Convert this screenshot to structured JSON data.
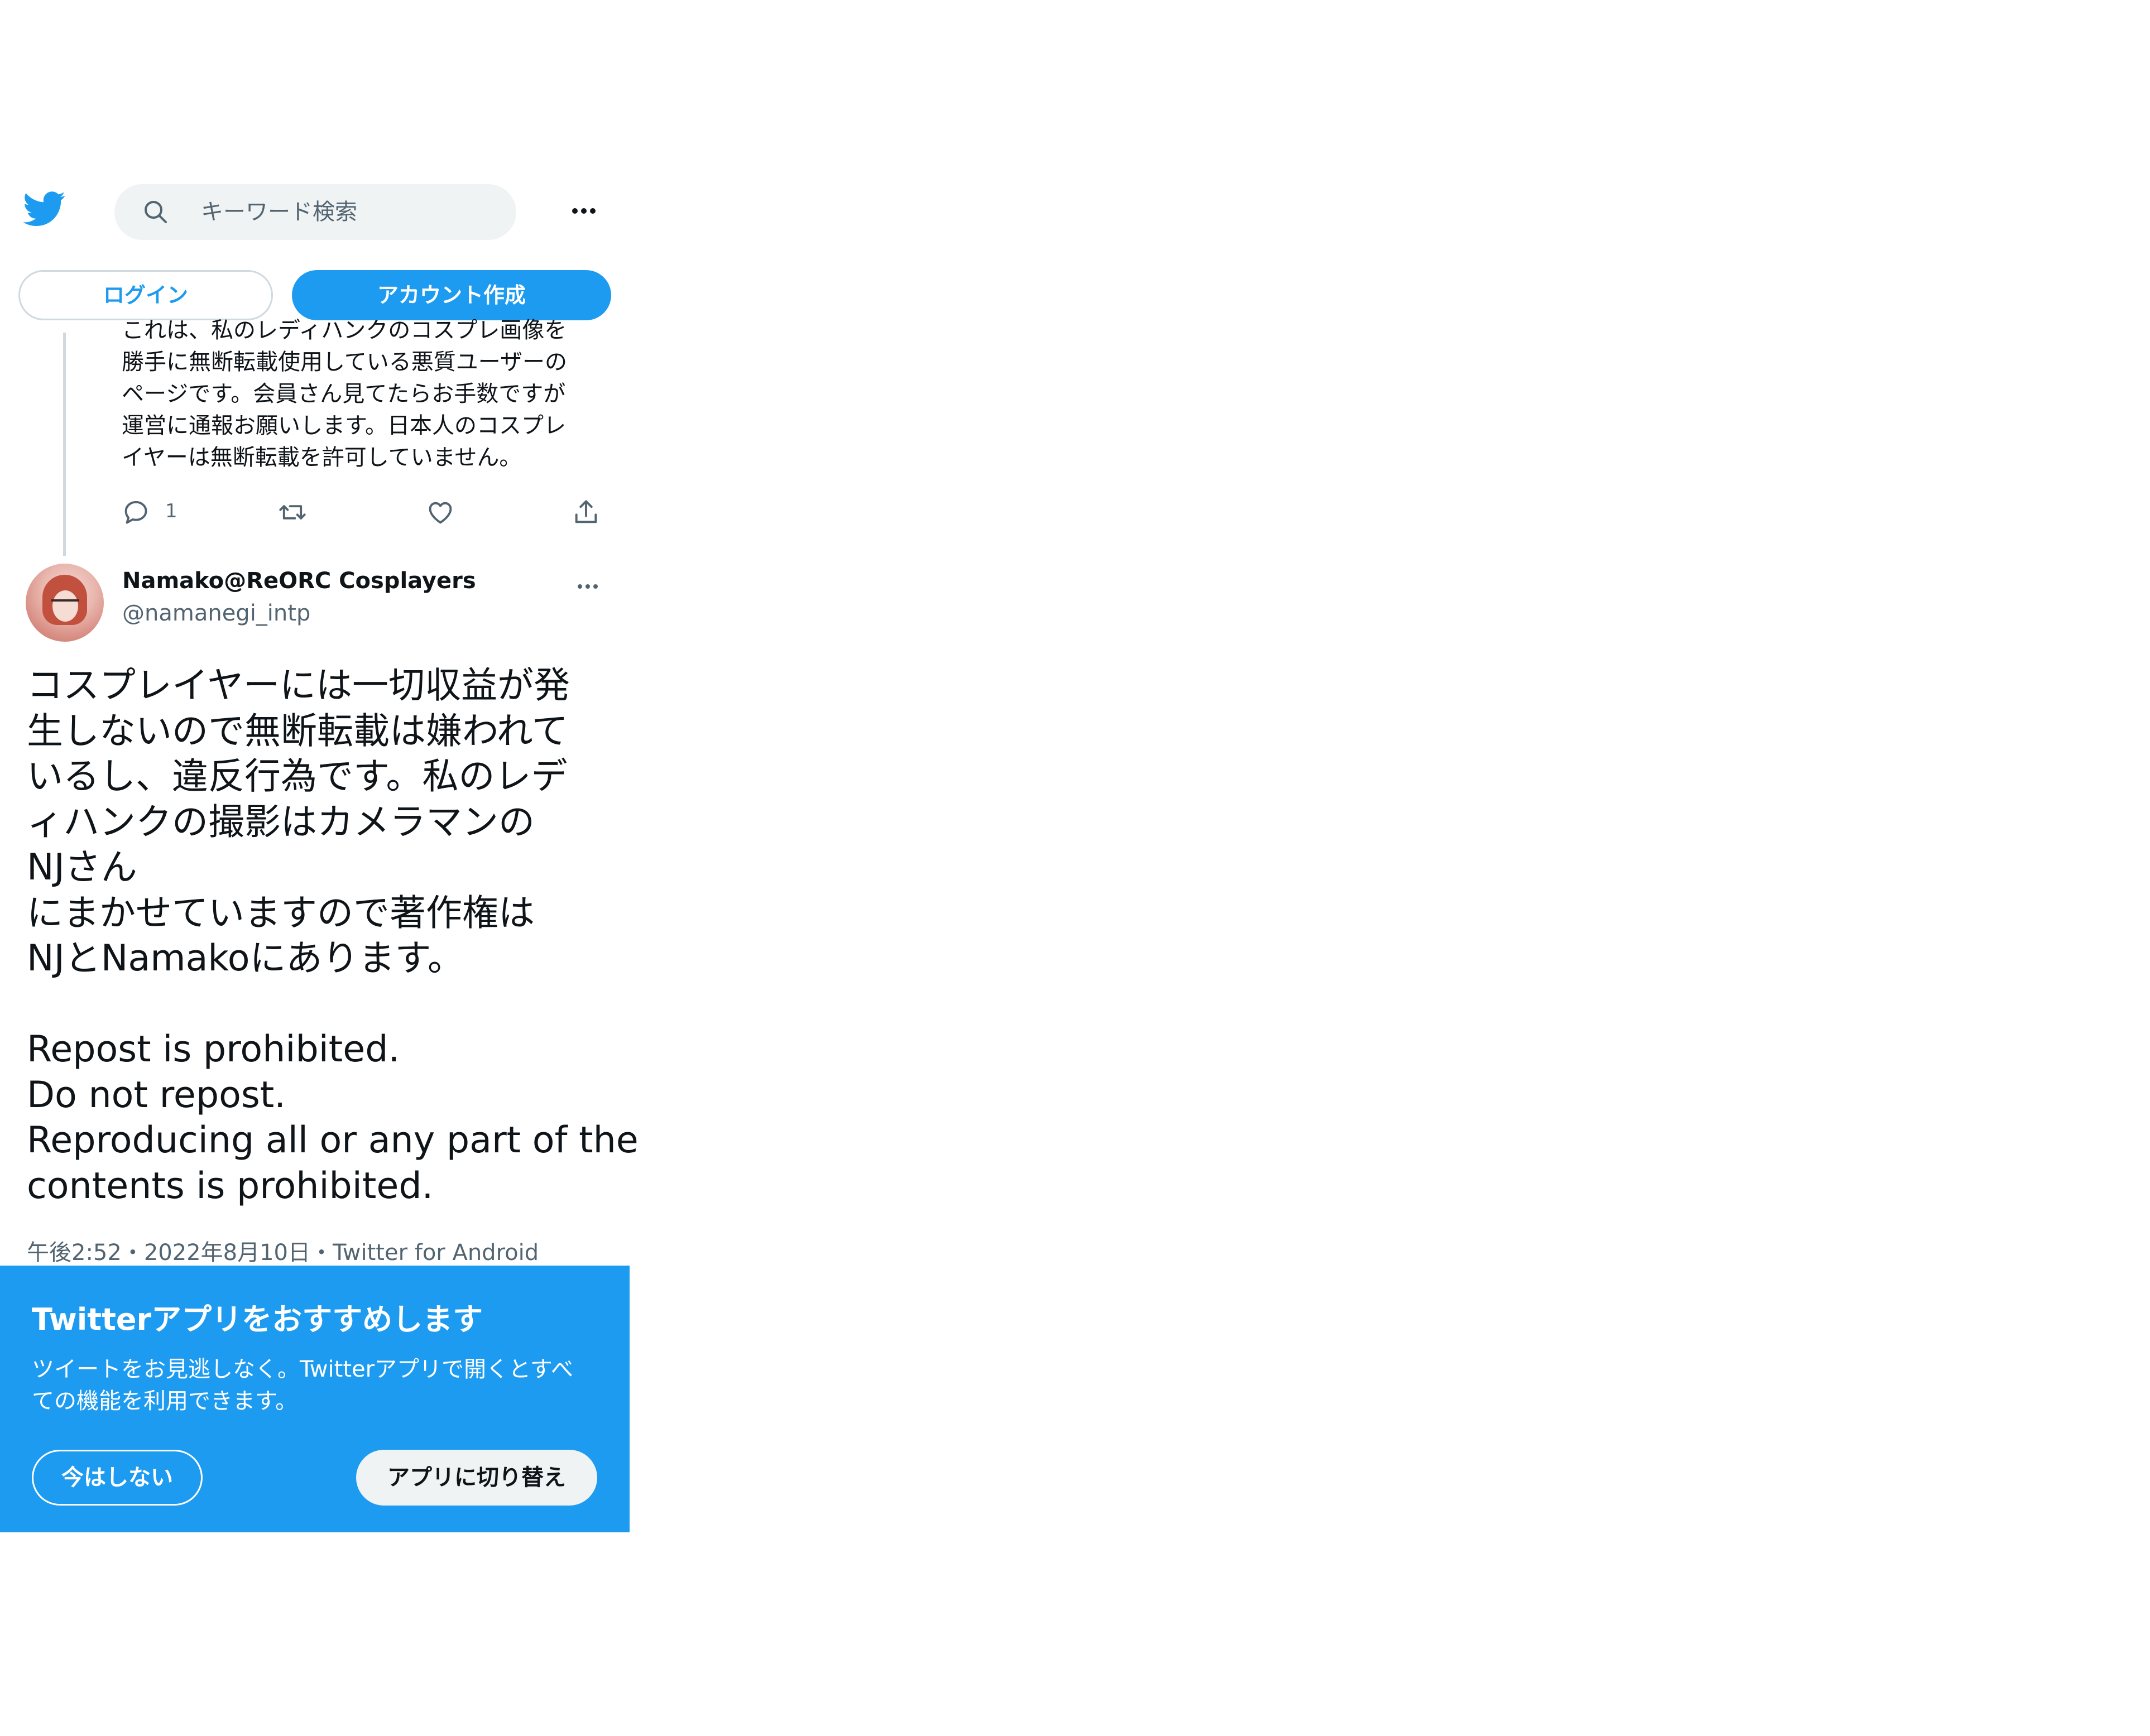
{
  "header": {
    "logo_icon": "twitter-bird-icon",
    "search": {
      "placeholder": "キーワード検索",
      "value": ""
    },
    "more_icon": "more-horizontal-icon"
  },
  "auth": {
    "login_label": "ログイン",
    "signup_label": "アカウント作成"
  },
  "previous_tweet": {
    "text_lines": [
      "これは、私のレディハンクのコスプレ画像を",
      "勝手に無断転載使用している悪質ユーザーの",
      "ページです。会員さん見てたらお手数ですが",
      "運営に通報お願いします。日本人のコスプレ",
      "イヤーは無断転載を許可していません。"
    ],
    "actions": {
      "reply_count": "1",
      "reply_icon": "reply-icon",
      "retweet_icon": "retweet-icon",
      "like_icon": "heart-icon",
      "share_icon": "share-icon"
    }
  },
  "tweet": {
    "display_name": "Namako@ReORC Cosplayers",
    "handle": "@namanegi_intp",
    "body_lines": [
      "コスプレイヤーには一切収益が発",
      "生しないので無断転載は嫌われて",
      "いるし、違反行為です。私のレデ",
      "ィハンクの撮影はカメラマンの",
      "NJさん",
      "にまかせていますので著作権は",
      "NJとNamakoにあります。",
      " ",
      "Repost is prohibited.",
      "Do not repost.",
      "Reproducing all or any part of the",
      "contents is prohibited."
    ],
    "timestamp": "午後2:52・2022年8月10日・Twitter for Android"
  },
  "app_banner": {
    "title": "Twitterアプリをおすすめします",
    "description_lines": [
      "ツイートをお見逃しなく。Twitterアプリで開くとすべ",
      "ての機能を利用できます。"
    ],
    "not_now_label": "今はしない",
    "switch_label": "アプリに切り替え"
  },
  "colors": {
    "brand_blue": "#1d9bf0",
    "text_primary": "#0f1419",
    "text_secondary": "#536471",
    "search_bg": "#eff3f4"
  }
}
